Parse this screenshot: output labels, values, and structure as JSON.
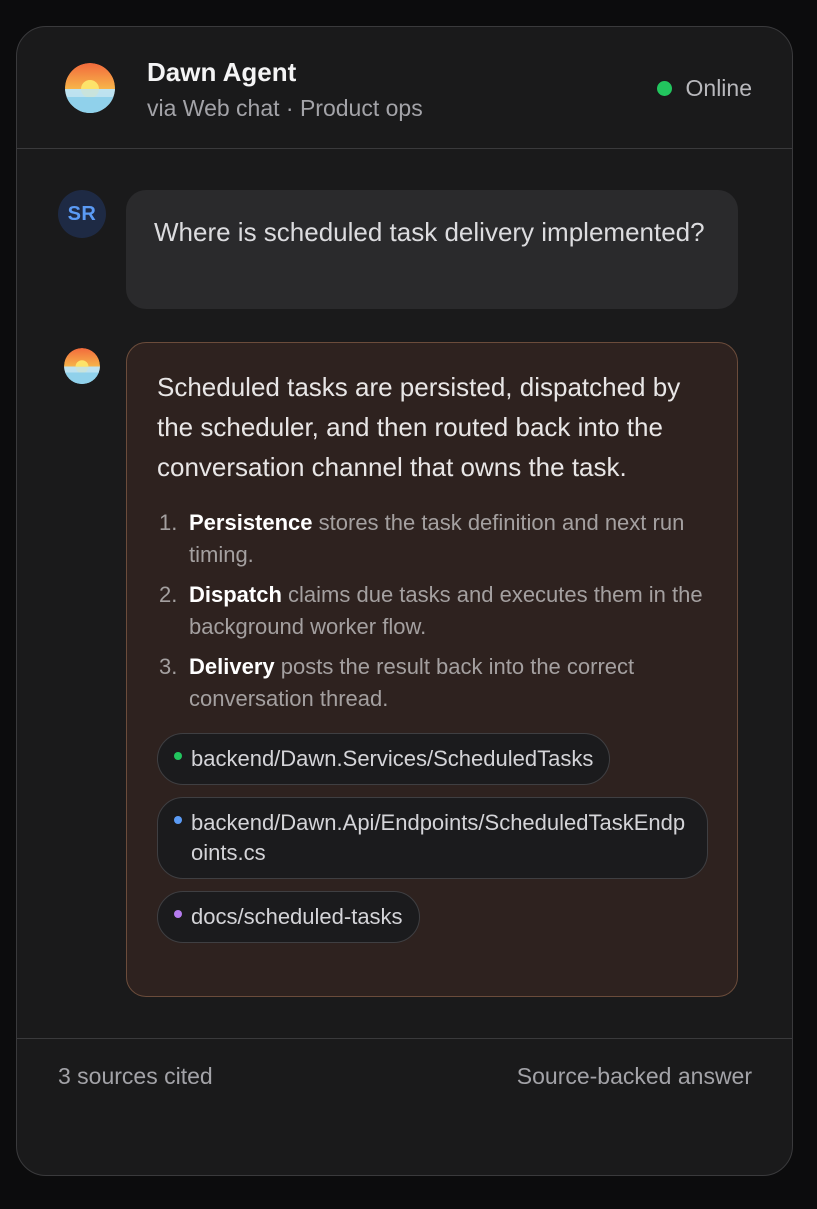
{
  "header": {
    "agent_name": "Dawn Agent",
    "agent_subtitle": "via Web chat · Product ops",
    "status_label": "Online",
    "status_color": "#22c55e",
    "avatar_icon": "sunrise-icon"
  },
  "messages": {
    "user": {
      "initials": "SR",
      "text": "Where is scheduled task delivery implemented?"
    },
    "bot": {
      "avatar_icon": "sunrise-icon",
      "intro": "Scheduled tasks are persisted, dispatched by the scheduler, and then routed back into the conversation channel that owns the task.",
      "steps": [
        {
          "num": "1.",
          "term": "Persistence",
          "text": " stores the task definition and next run timing."
        },
        {
          "num": "2.",
          "term": "Dispatch",
          "text": " claims due tasks and executes them in the background worker flow."
        },
        {
          "num": "3.",
          "term": "Delivery",
          "text": " posts the result back into the correct conversation thread."
        }
      ],
      "sources": [
        {
          "path": "backend/Dawn.Services/ScheduledTasks",
          "dot_color": "#22c55e"
        },
        {
          "path": "backend/Dawn.Api/Endpoints/ScheduledTaskEndpoints.cs",
          "dot_color": "#5b9bf5"
        },
        {
          "path": "docs/scheduled-tasks",
          "dot_color": "#b57bee"
        }
      ]
    }
  },
  "footer": {
    "sources_count": "3 sources cited",
    "answer_type": "Source-backed answer"
  }
}
